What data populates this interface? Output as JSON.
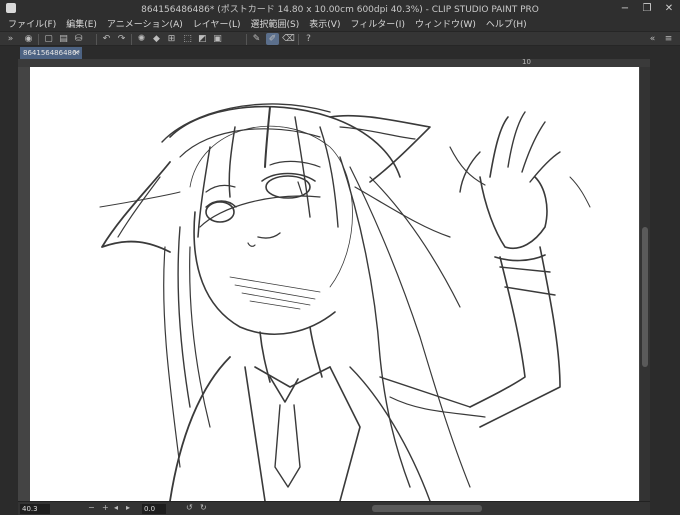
{
  "window": {
    "title": "864156486486* (ポストカード 14.80 x 10.00cm 600dpi 40.3%)  - CLIP STUDIO PAINT PRO",
    "controls": {
      "minimize": "−",
      "maximize": "❐",
      "close": "✕"
    }
  },
  "menu": {
    "items": [
      "ファイル(F)",
      "編集(E)",
      "アニメーション(A)",
      "レイヤー(L)",
      "選択範囲(S)",
      "表示(V)",
      "フィルター(I)",
      "ウィンドウ(W)",
      "ヘルプ(H)"
    ]
  },
  "toolbar": {
    "buttons": [
      {
        "name": "navigator-toggle-icon",
        "glyph": "»"
      },
      {
        "name": "app-logo-icon",
        "glyph": "◉"
      },
      {
        "name": "new-file-icon",
        "glyph": "▢"
      },
      {
        "name": "open-file-icon",
        "glyph": "▤"
      },
      {
        "name": "save-icon",
        "glyph": "⛁"
      },
      {
        "name": "undo-icon",
        "glyph": "↶"
      },
      {
        "name": "redo-icon",
        "glyph": "↷"
      },
      {
        "name": "loading-icon",
        "glyph": "✺"
      },
      {
        "name": "fill-icon",
        "glyph": "◆"
      },
      {
        "name": "transform-icon",
        "glyph": "⊞"
      },
      {
        "name": "clear-selection-icon",
        "glyph": "⬚"
      },
      {
        "name": "invert-selection-icon",
        "glyph": "◩"
      },
      {
        "name": "crop-icon",
        "glyph": "▣"
      },
      {
        "name": "pen-icon",
        "glyph": "✎"
      },
      {
        "name": "brush-icon",
        "glyph": "✐"
      },
      {
        "name": "eraser-icon",
        "glyph": "⌫"
      },
      {
        "name": "help-icon",
        "glyph": "?"
      }
    ],
    "right_glyphs": {
      "more": "«",
      "menu": "≡"
    }
  },
  "tab": {
    "label": "864156486486*",
    "close": "×"
  },
  "ruler": {
    "label": "10"
  },
  "statusbar": {
    "zoom": "40.3",
    "angle": "0.0",
    "glyphs": {
      "minus": "−",
      "plus": "+",
      "rotate_left": "↺",
      "rotate_right": "↻",
      "nav_left": "◂",
      "nav_right": "▸"
    }
  },
  "colors": {
    "background": "#2b2b2b",
    "tab_active": "#4d6383",
    "toolbar_active": "#5b6f8c",
    "canvas": "#ffffff",
    "sketch": "#3a3a3a"
  }
}
